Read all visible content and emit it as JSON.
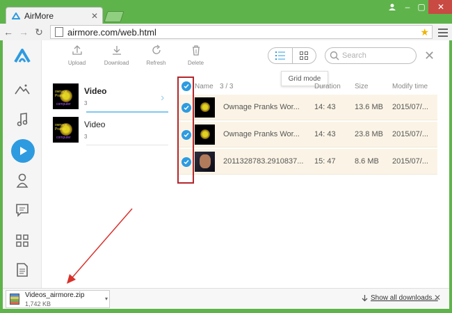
{
  "browser": {
    "tab_title": "AirMore",
    "url": "airmore.com/web.html"
  },
  "actions": [
    {
      "label": "Upload"
    },
    {
      "label": "Download"
    },
    {
      "label": "Refresh"
    },
    {
      "label": "Delete"
    }
  ],
  "search": {
    "placeholder": "Search"
  },
  "tooltip": {
    "text": "Grid mode"
  },
  "categories": [
    {
      "name": "Video",
      "count": "3"
    },
    {
      "name": "Video",
      "count": "3"
    }
  ],
  "table": {
    "headers": {
      "name": "Name",
      "selection": "3 / 3",
      "duration": "Duration",
      "size": "Size",
      "date": "Modify time"
    },
    "rows": [
      {
        "name": "Ownage Pranks Wor...",
        "duration": "14: 43",
        "size": "13.6 MB",
        "date": "2015/07/..."
      },
      {
        "name": "Ownage Pranks Wor...",
        "duration": "14: 43",
        "size": "23.8 MB",
        "date": "2015/07/..."
      },
      {
        "name": "2011328783.2910837...",
        "duration": "15: 47",
        "size": "8.6 MB",
        "date": "2015/07/..."
      }
    ]
  },
  "thumb_text": {
    "line1": "ownage Pranks",
    "line2": "computer"
  },
  "downloads": {
    "file_name": "Videos_airmore.zip",
    "file_size": "1,742 KB",
    "show_all": "Show all downloads..."
  },
  "colors": {
    "accent": "#2e9be0",
    "highlight_box": "#b3262b",
    "row_bg": "#fbf4e6"
  }
}
